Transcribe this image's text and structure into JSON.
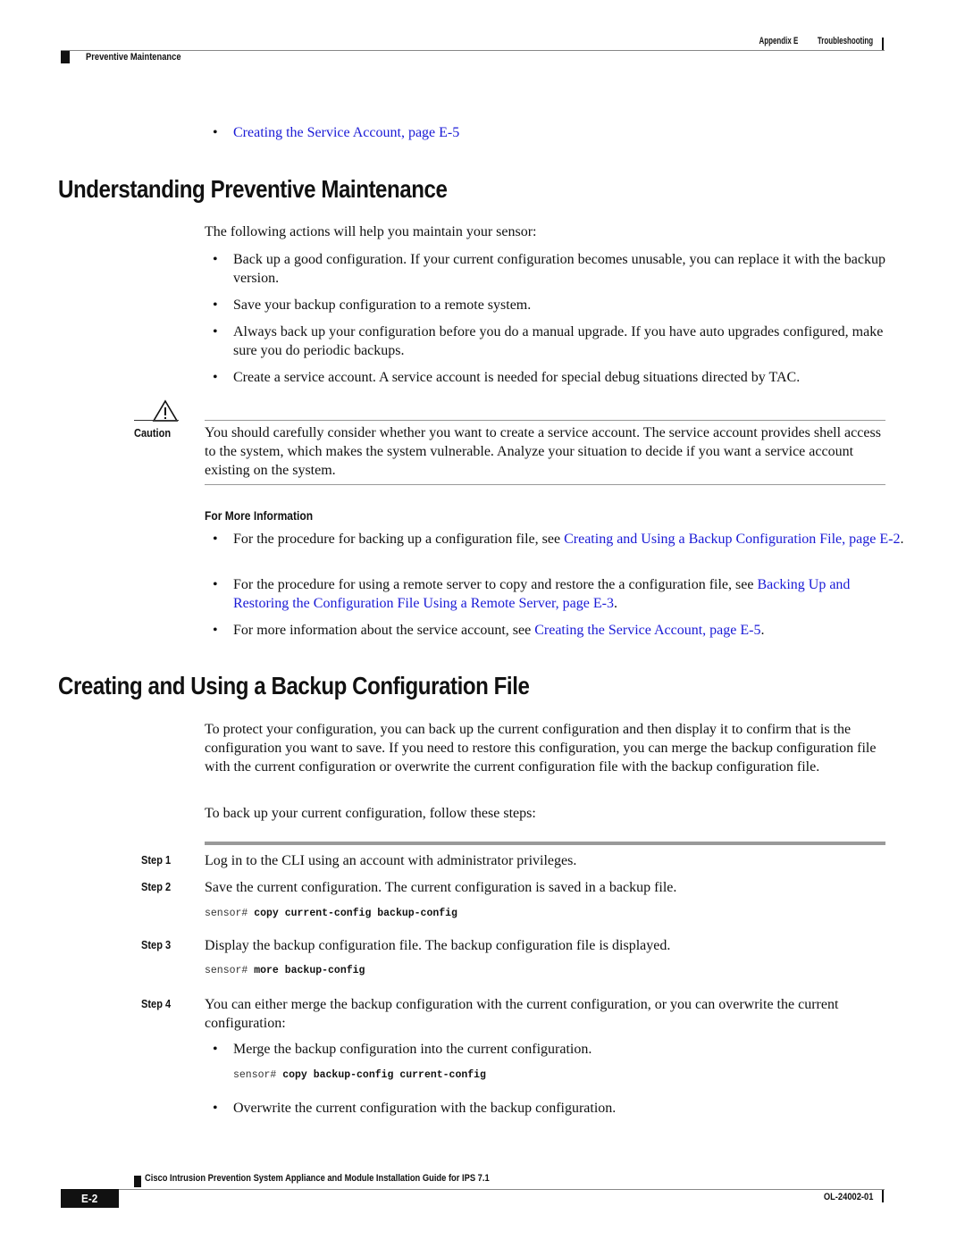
{
  "header": {
    "chapter": "Appendix E",
    "chapter_title": "Troubleshooting",
    "section": "Preventive Maintenance"
  },
  "top_link": "Creating the Service Account, page E-5",
  "section1": {
    "title": "Understanding Preventive Maintenance",
    "intro": "The following actions will help you maintain your sensor:",
    "bullets": [
      "Back up a good configuration. If your current configuration becomes unusable, you can replace it with the backup version.",
      "Save your backup configuration to a remote system.",
      "Always back up your configuration before you do a manual upgrade. If you have auto upgrades configured, make sure you do periodic backups.",
      "Create a service account. A service account is needed for special debug situations directed by TAC."
    ],
    "caution_label": "Caution",
    "caution_text": "You should carefully consider whether you want to create a service account. The service account provides shell access to the system, which makes the system vulnerable. Analyze your situation to decide if you want a service account existing on the system.",
    "more_info_heading": "For More Information",
    "more_info": [
      {
        "text": "For the procedure for backing up a configuration file, see ",
        "link": "Creating and Using a Backup Configuration File, page E-2",
        "after": "."
      },
      {
        "text": "For the procedure for using a remote server to copy and restore the a configuration file, see ",
        "link": "Backing Up and Restoring the Configuration File Using a Remote Server, page E-3",
        "after": "."
      },
      {
        "text": "For more information about the service account, see ",
        "link": "Creating the Service Account, page E-5",
        "after": "."
      }
    ]
  },
  "section2": {
    "title": "Creating and Using a Backup Configuration File",
    "intro": "To protect your configuration, you can back up the current configuration and then display it to confirm that is the configuration you want to save. If you need to restore this configuration, you can merge the backup configuration file with the current configuration or overwrite the current configuration file with the backup configuration file.",
    "lead": "To back up your current configuration, follow these steps:",
    "steps": [
      {
        "label": "Step 1",
        "text": "Log in to the CLI using an account with administrator privileges."
      },
      {
        "label": "Step 2",
        "text": "Save the current configuration. The current configuration is saved in a backup file.",
        "prompt": "sensor# ",
        "cmd": "copy current-config backup-config"
      },
      {
        "label": "Step 3",
        "text": "Display the backup configuration file. The backup configuration file is displayed.",
        "prompt": "sensor# ",
        "cmd": "more backup-config"
      },
      {
        "label": "Step 4",
        "text": "You can either merge the backup configuration with the current configuration, or you can overwrite the current configuration:"
      }
    ],
    "step4_bullets": [
      {
        "text": "Merge the backup configuration into the current configuration.",
        "prompt": "sensor# ",
        "cmd": "copy backup-config current-config"
      },
      {
        "text": "Overwrite the current configuration with the backup configuration."
      }
    ]
  },
  "footer": {
    "guide_title": "Cisco Intrusion Prevention System Appliance and Module Installation Guide for IPS 7.1",
    "page": "E-2",
    "doc_number": "OL-24002-01"
  }
}
